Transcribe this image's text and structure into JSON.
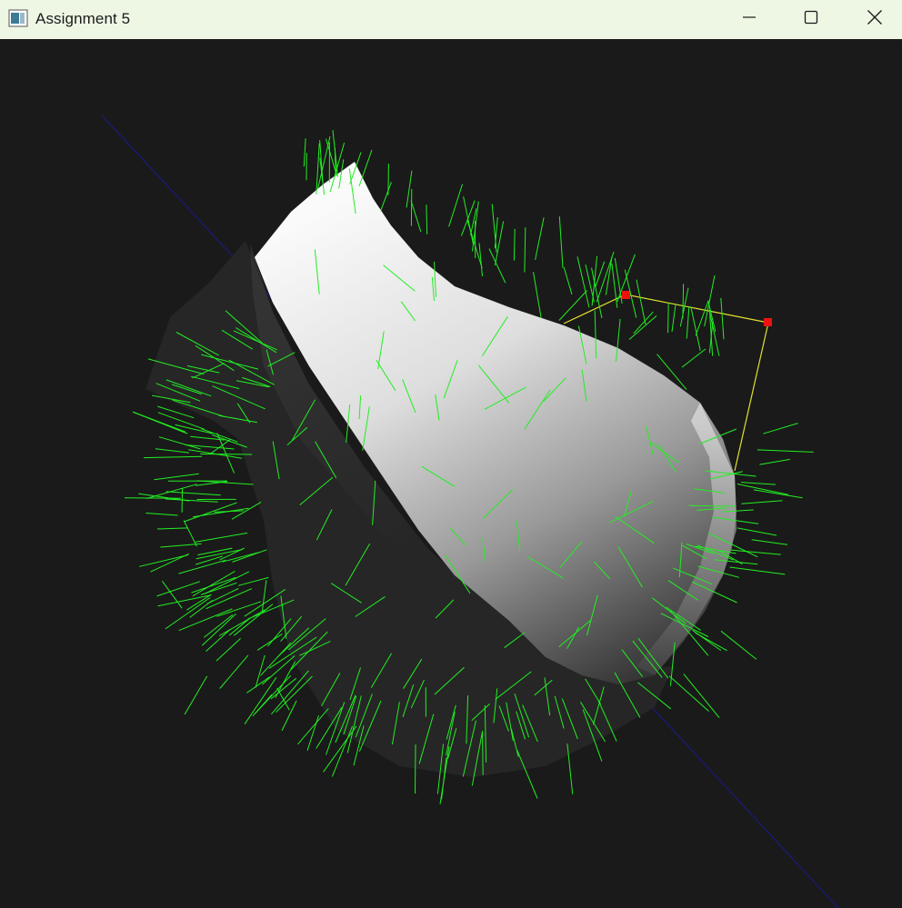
{
  "window": {
    "title": "Assignment 5",
    "icons": {
      "app": "app-window-icon",
      "minimize": "minimize-icon",
      "maximize": "maximize-icon",
      "close": "close-icon"
    }
  },
  "scene": {
    "background_color": "#1a1a1a",
    "axis_color": "#1a1a6e",
    "normal_color": "#22ee22",
    "control_polygon_color": "#e0e030",
    "control_point_color": "#ee1111",
    "surface_light": "#f4f4f4",
    "surface_dark": "#262626",
    "control_points_visible": 2
  }
}
